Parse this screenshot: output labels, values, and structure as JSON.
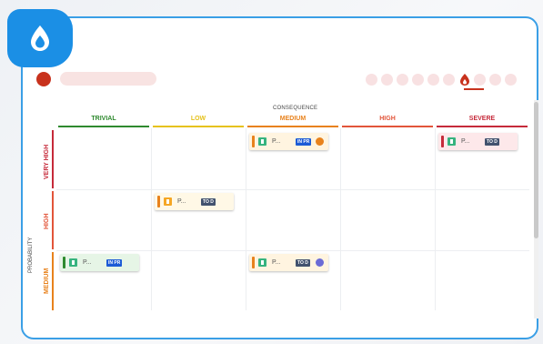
{
  "app": {
    "logo_icon": "flame-drop-logo-icon",
    "brand_color": "#1b8fe5",
    "accent_color": "#c8321d"
  },
  "toolbar": {
    "nav_icons": [
      "nav-circle",
      "nav-circle",
      "nav-circle",
      "nav-circle",
      "nav-circle",
      "nav-circle",
      "flame-icon",
      "nav-circle",
      "nav-circle",
      "nav-circle"
    ],
    "active_index": 6
  },
  "matrix": {
    "consequence_label": "CONSEQUENCE",
    "probability_label": "PROBABILITY",
    "columns": [
      {
        "label": "TRIVIAL",
        "color": "#2f8a2f"
      },
      {
        "label": "LOW",
        "color": "#e6c21c"
      },
      {
        "label": "MEDIUM",
        "color": "#e8821c"
      },
      {
        "label": "HIGH",
        "color": "#e2553a"
      },
      {
        "label": "SEVERE",
        "color": "#c62a3a"
      }
    ],
    "rows": [
      {
        "label": "VERY HIGH",
        "color": "#c62a3a"
      },
      {
        "label": "HIGH",
        "color": "#e2553a"
      },
      {
        "label": "MEDIUM",
        "color": "#e8821c"
      }
    ]
  },
  "cards": [
    {
      "title": "P...",
      "status": "IN PR",
      "status_color": "#1c5bd6",
      "type_icon": "bookmark-icon",
      "type_color": "#36b37e",
      "stripe_color": "#e8821c",
      "bg": "#fff4e0",
      "avatar": "avatar-icon",
      "avatar_color": "#e8821c",
      "cell": "very-high-medium"
    },
    {
      "title": "P...",
      "status": "TO D",
      "status_color": "#42526e",
      "type_icon": "bookmark-icon",
      "type_color": "#36b37e",
      "stripe_color": "#c62a3a",
      "bg": "#fde8ea",
      "avatar": "",
      "cell": "very-high-severe"
    },
    {
      "title": "P...",
      "status": "TO D",
      "status_color": "#42526e",
      "type_icon": "bulb-icon",
      "type_color": "#f5a623",
      "stripe_color": "#e8821c",
      "bg": "#fff8e6",
      "avatar": "",
      "cell": "high-low"
    },
    {
      "title": "P...",
      "status": "IN PR",
      "status_color": "#1c5bd6",
      "type_icon": "bookmark-icon",
      "type_color": "#36b37e",
      "stripe_color": "#2f8a2f",
      "bg": "#e6f5e6",
      "avatar": "",
      "cell": "medium-trivial"
    },
    {
      "title": "P...",
      "status": "TO D",
      "status_color": "#42526e",
      "type_icon": "bookmark-icon",
      "type_color": "#36b37e",
      "stripe_color": "#e8821c",
      "bg": "#fff4e0",
      "avatar": "avatar-icon",
      "avatar_color": "#6b6bd6",
      "cell": "medium-medium"
    }
  ]
}
